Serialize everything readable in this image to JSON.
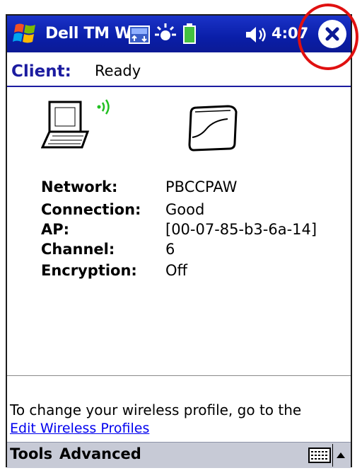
{
  "titlebar": {
    "title": "Dell TM W",
    "clock": "4:07"
  },
  "header": {
    "client_label": "Client:",
    "client_status": "Ready"
  },
  "details": {
    "network_label": "Network:",
    "network_value": "PBCCPAW",
    "connection_label": "Connection:",
    "connection_value": "Good",
    "ap_label": "AP:",
    "ap_value": "[00-07-85-b3-6a-14]",
    "channel_label": "Channel:",
    "channel_value": "6",
    "encryption_label": "Encryption:",
    "encryption_value": "Off"
  },
  "info": {
    "text": "To change your wireless profile, go to the",
    "link": "Edit Wireless Profiles"
  },
  "menubar": {
    "tools": "Tools",
    "advanced": "Advanced"
  },
  "icons": {
    "start": "windows-flag-icon",
    "connectivity": "connectivity-icon",
    "notification": "notification-icon",
    "battery": "battery-icon",
    "volume": "volume-icon",
    "close": "close-icon",
    "laptop": "laptop-icon",
    "signal": "signal-icon",
    "card": "wireless-card-icon",
    "keyboard": "keyboard-icon"
  },
  "colors": {
    "titlebar": "#0a1ea8",
    "client_label": "#1c1ca0",
    "signal": "#22c022",
    "link": "#0000ee",
    "menubar": "#c7cad6",
    "highlight": "#e01010"
  }
}
